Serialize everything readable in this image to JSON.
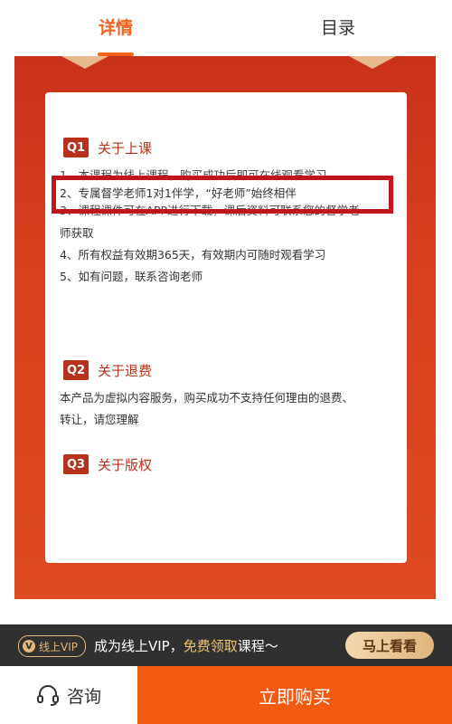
{
  "tabs": [
    {
      "label": "详情",
      "active": true
    },
    {
      "label": "目录",
      "active": false
    }
  ],
  "sections": [
    {
      "badge": "Q1",
      "title": "关于上课",
      "items": [
        "1、本课程为线上课程，购买成功后即可在线观看学习",
        "2、专属督学老师1对1伴学，“好老师”始终相伴",
        "3、课程课件可在APP进行下载，课后资料可联系您的督学老",
        "师获取",
        "4、所有权益有效期365天，有效期内可随时观看学习",
        "5、如有问题，联系咨询老师"
      ]
    },
    {
      "badge": "Q2",
      "title": "关于退费",
      "text": [
        "本产品为虚拟内容服务，购买成功不支持任何理由的退费、",
        "转让，请您理解"
      ]
    },
    {
      "badge": "Q3",
      "title": "关于版权"
    }
  ],
  "promo": {
    "vip_tag": "线上VIP",
    "vip_glyph": "V",
    "text_prefix": "成为线上VIP，",
    "text_highlight": "免费领取",
    "text_suffix": "课程～",
    "button": "马上看看"
  },
  "bottom_bar": {
    "consult_label": "咨询",
    "buy_label": "立即购买"
  },
  "colors": {
    "accent": "#f2621b",
    "banner_red": "#d8401e",
    "highlight_box": "#c0151d",
    "buy_button": "#f25a12"
  }
}
